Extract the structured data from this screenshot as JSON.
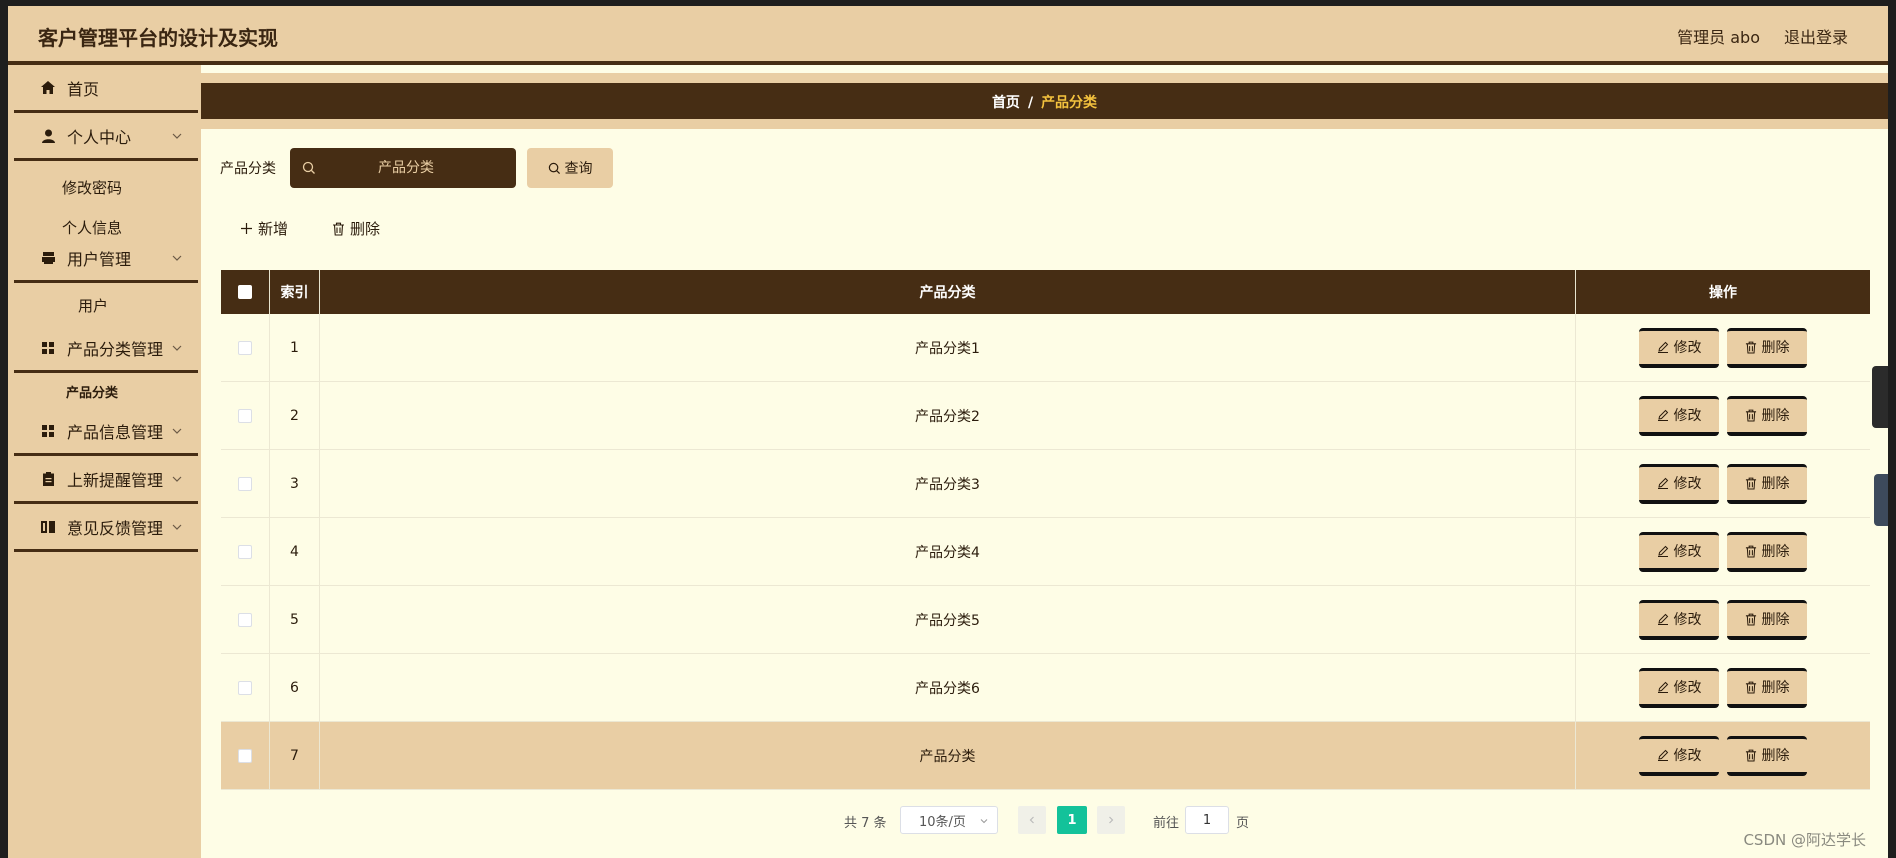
{
  "header": {
    "title": "客户管理平台的设计及实现",
    "user_label": "管理员 abo",
    "logout_label": "退出登录"
  },
  "sidebar": {
    "items": [
      {
        "label": "首页",
        "icon": "home-icon"
      },
      {
        "label": "个人中心",
        "icon": "user-icon"
      },
      {
        "label": "修改密码"
      },
      {
        "label": "个人信息"
      },
      {
        "label": "用户管理",
        "icon": "folder-icon"
      },
      {
        "label": "用户"
      },
      {
        "label": "产品分类管理",
        "icon": "grid-icon"
      },
      {
        "label": "产品分类"
      },
      {
        "label": "产品信息管理",
        "icon": "grid-icon"
      },
      {
        "label": "上新提醒管理",
        "icon": "clipboard-icon"
      },
      {
        "label": "意见反馈管理",
        "icon": "book-icon"
      }
    ]
  },
  "breadcrumb": {
    "home": "首页",
    "separator": "/",
    "current": "产品分类"
  },
  "search": {
    "label": "产品分类",
    "placeholder": "产品分类",
    "button": "查询"
  },
  "toolbar": {
    "add_label": "新增",
    "delete_label": "删除"
  },
  "table": {
    "headers": {
      "index": "索引",
      "name": "产品分类",
      "ops": "操作"
    },
    "rows": [
      {
        "index": "1",
        "name": "产品分类1"
      },
      {
        "index": "2",
        "name": "产品分类2"
      },
      {
        "index": "3",
        "name": "产品分类3"
      },
      {
        "index": "4",
        "name": "产品分类4"
      },
      {
        "index": "5",
        "name": "产品分类5"
      },
      {
        "index": "6",
        "name": "产品分类6"
      },
      {
        "index": "7",
        "name": "产品分类"
      }
    ],
    "edit_label": "修改",
    "delete_label": "删除"
  },
  "pagination": {
    "total": "共 7 条",
    "page_size": "10条/页",
    "current_page": "1",
    "goto_label": "前往",
    "goto_value": "1",
    "page_suffix": "页"
  },
  "watermark": "CSDN @阿达学长",
  "colors": {
    "primary_brown": "#462d14",
    "tan": "#e9cea4",
    "background": "#fefde6",
    "active_page": "#13c29a",
    "breadcrumb_current": "#f4c23e"
  }
}
